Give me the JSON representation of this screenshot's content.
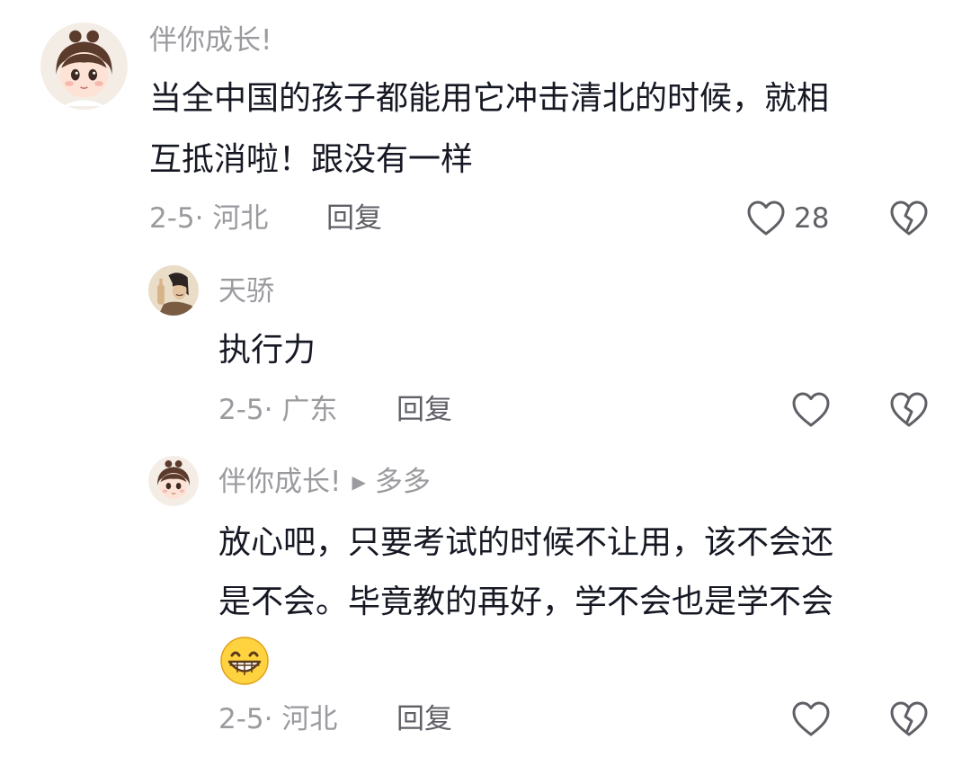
{
  "comments": [
    {
      "name": "伴你成长!",
      "text_lines": [
        "当全中国的孩子都能用它冲击清北的时候，就相",
        "互抵消啦！跟没有一样"
      ],
      "meta": "2-5· 河北",
      "reply_label": "回复",
      "like_count": "28",
      "like_icon": "heart-outline-icon",
      "dislike_icon": "broken-heart-icon"
    },
    {
      "name": "天骄",
      "text_lines": [
        "执行力"
      ],
      "meta": "2-5· 广东",
      "reply_label": "回复",
      "like_icon": "heart-outline-icon",
      "dislike_icon": "broken-heart-icon"
    },
    {
      "name": "伴你成长!",
      "reply_to": "多多",
      "text_lines": [
        "放心吧，只要考试的时候不让用，该不会还",
        "是不会。毕竟教的再好，学不会也是学不会"
      ],
      "emoji": "grinning-face-emoji",
      "meta": "2-5· 河北",
      "reply_label": "回复",
      "like_icon": "heart-outline-icon",
      "dislike_icon": "broken-heart-icon"
    }
  ],
  "colors": {
    "primary_text": "#161823",
    "secondary_text": "#9a9a9f",
    "action_text": "#5f5f66",
    "icon_stroke": "#5f5f66"
  }
}
